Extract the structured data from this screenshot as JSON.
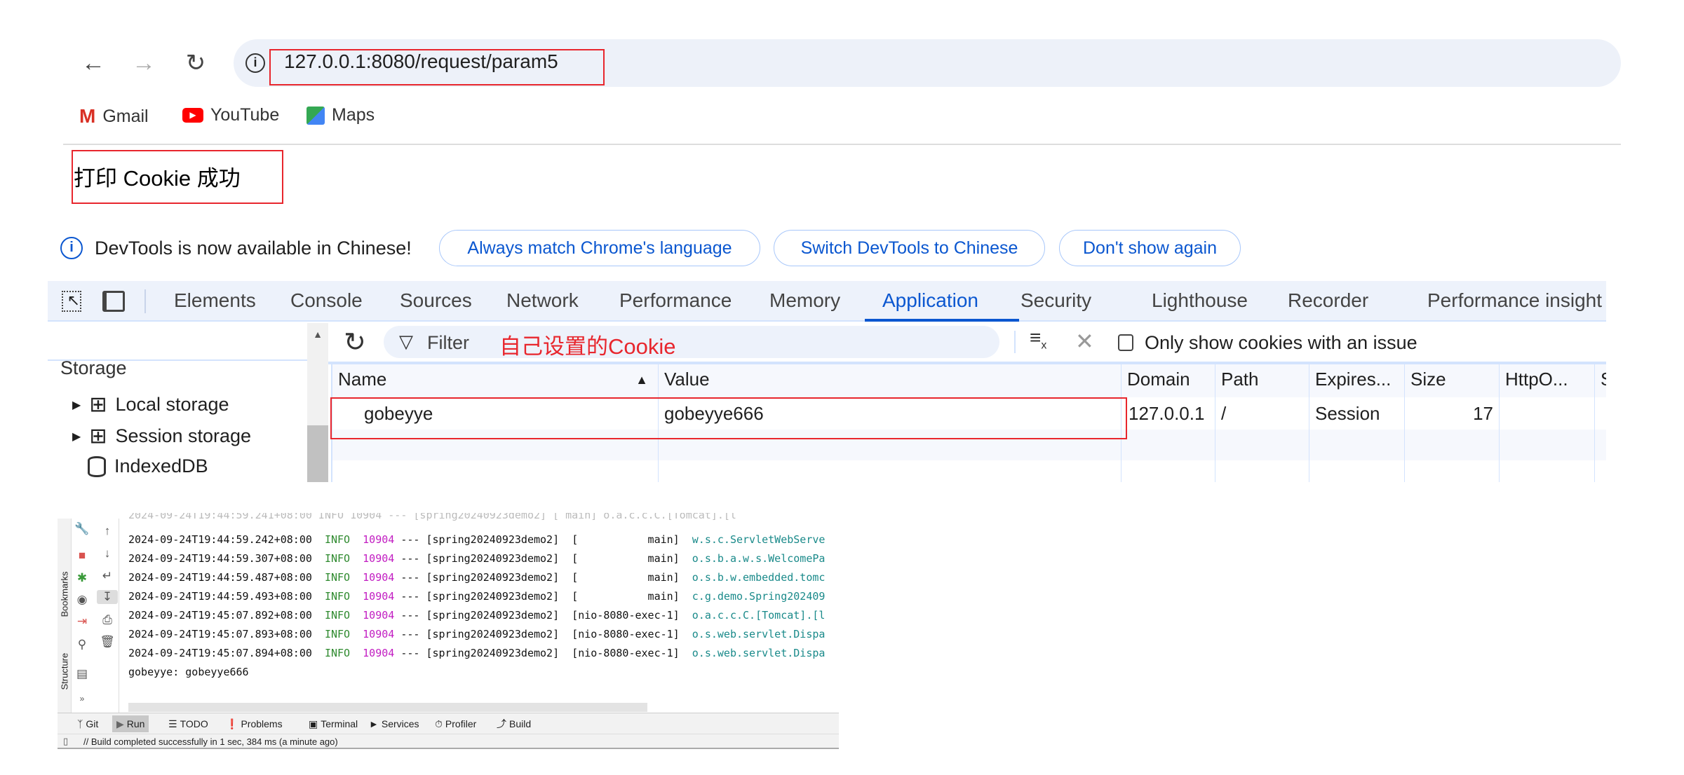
{
  "browser": {
    "url": "127.0.0.1:8080/request/param5",
    "back_icon": "arrow-left",
    "forward_icon": "arrow-right",
    "reload_icon": "reload",
    "info_icon": "info-circle",
    "bookmarks": [
      {
        "label": "Gmail",
        "icon": "gmail-logo"
      },
      {
        "label": "YouTube",
        "icon": "youtube-logo"
      },
      {
        "label": "Maps",
        "icon": "maps-logo"
      }
    ]
  },
  "page": {
    "message": "打印 Cookie 成功"
  },
  "infobar": {
    "text": "DevTools is now available in Chinese!",
    "buttons": [
      "Always match Chrome's language",
      "Switch DevTools to Chinese",
      "Don't show again"
    ]
  },
  "devtools": {
    "tabs": [
      "Elements",
      "Console",
      "Sources",
      "Network",
      "Performance",
      "Memory",
      "Application",
      "Security",
      "Lighthouse",
      "Recorder",
      "Performance insight"
    ],
    "active_tab": "Application",
    "sidebar": {
      "section": "Storage",
      "items": [
        "Local storage",
        "Session storage",
        "IndexedDB"
      ]
    },
    "toolbar": {
      "filter_placeholder": "Filter",
      "annotation": "自己设置的Cookie",
      "only_issues_label": "Only show cookies with an issue",
      "only_issues_checked": false
    },
    "table": {
      "columns": [
        "Name",
        "Value",
        "Domain",
        "Path",
        "Expires...",
        "Size",
        "HttpO...",
        "S"
      ],
      "rows": [
        {
          "name": "gobeyye",
          "value": "gobeyye666",
          "domain": "127.0.0.1",
          "path": "/",
          "expires": "Session",
          "size": "17",
          "httponly": ""
        }
      ]
    }
  },
  "ide": {
    "side_labels": [
      "Bookmarks",
      "Structure"
    ],
    "log": [
      {
        "ts": "2024-09-24T19:44:59.242+08:00",
        "level": "INFO",
        "pid": "10904",
        "app": "[spring20240923demo2]",
        "thread": "[           main]",
        "logger": "w.s.c.ServletWebServe"
      },
      {
        "ts": "2024-09-24T19:44:59.307+08:00",
        "level": "INFO",
        "pid": "10904",
        "app": "[spring20240923demo2]",
        "thread": "[           main]",
        "logger": "o.s.b.a.w.s.WelcomePa"
      },
      {
        "ts": "2024-09-24T19:44:59.487+08:00",
        "level": "INFO",
        "pid": "10904",
        "app": "[spring20240923demo2]",
        "thread": "[           main]",
        "logger": "o.s.b.w.embedded.tomc"
      },
      {
        "ts": "2024-09-24T19:44:59.493+08:00",
        "level": "INFO",
        "pid": "10904",
        "app": "[spring20240923demo2]",
        "thread": "[           main]",
        "logger": "c.g.demo.Spring202409"
      },
      {
        "ts": "2024-09-24T19:45:07.892+08:00",
        "level": "INFO",
        "pid": "10904",
        "app": "[spring20240923demo2]",
        "thread": "[nio-8080-exec-1]",
        "logger": "o.a.c.c.C.[Tomcat].[l"
      },
      {
        "ts": "2024-09-24T19:45:07.893+08:00",
        "level": "INFO",
        "pid": "10904",
        "app": "[spring20240923demo2]",
        "thread": "[nio-8080-exec-1]",
        "logger": "o.s.web.servlet.Dispa"
      },
      {
        "ts": "2024-09-24T19:45:07.894+08:00",
        "level": "INFO",
        "pid": "10904",
        "app": "[spring20240923demo2]",
        "thread": "[nio-8080-exec-1]",
        "logger": "o.s.web.servlet.Dispa"
      }
    ],
    "output": "gobeyye: gobeyye666",
    "tool_tabs": [
      "Git",
      "Run",
      "TODO",
      "Problems",
      "Terminal",
      "Services",
      "Profiler",
      "Build"
    ],
    "active_tool_tab": "Run",
    "status": "// Build completed successfully in 1 sec, 384 ms (a minute ago)"
  },
  "colors": {
    "accent": "#0b57d0",
    "annotation_red": "#e8262d",
    "info_green": "#2f8a2f",
    "pid_magenta": "#c21dc2",
    "logger_teal": "#1a8a8a"
  }
}
